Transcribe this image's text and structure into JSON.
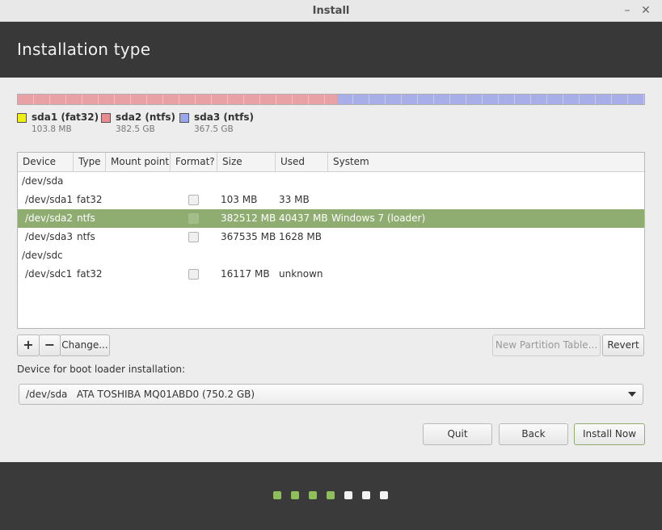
{
  "window": {
    "title": "Install",
    "minimize_glyph": "–",
    "close_glyph": "✕"
  },
  "header": {
    "title": "Installation type"
  },
  "disk_bar": {
    "segments": [
      {
        "name": "sda1 (fat32)",
        "fraction": 0.0001,
        "color": "#e9ea28"
      },
      {
        "name": "sda2 (ntfs)",
        "fraction": 0.51,
        "color": "#e8a2a6"
      },
      {
        "name": "sda3 (ntfs)",
        "fraction": 0.49,
        "color": "#a7aee8"
      }
    ]
  },
  "legend": [
    {
      "name": "sda1 (fat32)",
      "size": "103.8 MB",
      "color": "#f0ee10"
    },
    {
      "name": "sda2 (ntfs)",
      "size": "382.5 GB",
      "color": "#e98b8f"
    },
    {
      "name": "sda3 (ntfs)",
      "size": "367.5 GB",
      "color": "#9aa6ec"
    }
  ],
  "table": {
    "columns": [
      "Device",
      "Type",
      "Mount point",
      "Format?",
      "Size",
      "Used",
      "System"
    ],
    "rows": [
      {
        "device": "/dev/sda",
        "type": "",
        "mount": "",
        "format": false,
        "has_checkbox": false,
        "size": "",
        "used": "",
        "system": "",
        "selected": false
      },
      {
        "device": "/dev/sda1",
        "type": "fat32",
        "mount": "",
        "format": false,
        "has_checkbox": true,
        "size": "103 MB",
        "used": "33 MB",
        "system": "",
        "selected": false
      },
      {
        "device": "/dev/sda2",
        "type": "ntfs",
        "mount": "",
        "format": false,
        "has_checkbox": true,
        "size": "382512 MB",
        "used": "40437 MB",
        "system": "Windows 7 (loader)",
        "selected": true
      },
      {
        "device": "/dev/sda3",
        "type": "ntfs",
        "mount": "",
        "format": false,
        "has_checkbox": true,
        "size": "367535 MB",
        "used": "1628 MB",
        "system": "",
        "selected": false
      },
      {
        "device": "/dev/sdc",
        "type": "",
        "mount": "",
        "format": false,
        "has_checkbox": false,
        "size": "",
        "used": "",
        "system": "",
        "selected": false
      },
      {
        "device": "/dev/sdc1",
        "type": "fat32",
        "mount": "",
        "format": false,
        "has_checkbox": true,
        "size": "16117 MB",
        "used": "unknown",
        "system": "",
        "selected": false
      }
    ]
  },
  "partition_buttons": {
    "add": "+",
    "remove": "−",
    "change": "Change...",
    "new_table": "New Partition Table...",
    "revert": "Revert"
  },
  "bootloader": {
    "label": "Device for boot loader installation:",
    "selected": "/dev/sda   ATA TOSHIBA MQ01ABD0 (750.2 GB)"
  },
  "actions": {
    "quit": "Quit",
    "back": "Back",
    "install": "Install Now"
  },
  "progress": {
    "total_steps": 7,
    "completed_steps": 4
  },
  "colors": {
    "accent": "#8fad71",
    "header_bg": "#383838",
    "footer_bg": "#3a3a3a",
    "step_done": "#8fbf5a",
    "step_todo": "#f2f2f2"
  }
}
